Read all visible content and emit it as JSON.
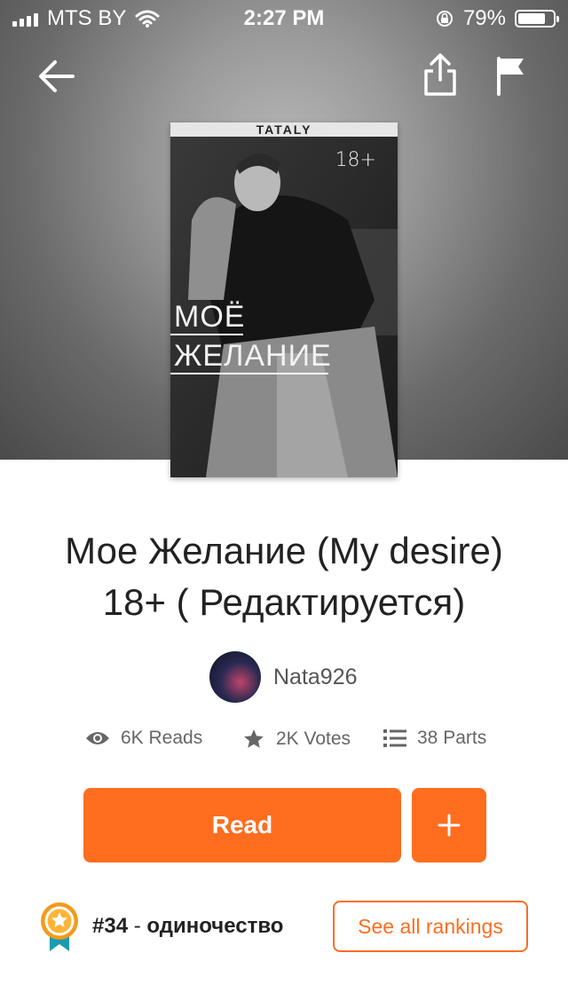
{
  "status_bar": {
    "carrier": "MTS BY",
    "time": "2:27 PM",
    "battery": "79%",
    "battery_level": 0.79
  },
  "nav": {
    "back_icon": "arrow-left-icon",
    "share_icon": "share-icon",
    "flag_icon": "flag-icon"
  },
  "cover": {
    "brand": "TATALY",
    "age_rating": "18+",
    "title_line1": "МОЁ",
    "title_line2": "ЖЕЛАНИЕ"
  },
  "story": {
    "title_line1": "Мое Желание (My desire)",
    "title_line2": "18+ ( Редактируется)"
  },
  "author": {
    "name": "Nata926"
  },
  "stats": {
    "reads": "6K Reads",
    "votes": "2K Votes",
    "parts": "38 Parts"
  },
  "actions": {
    "read_label": "Read",
    "add_label": "+"
  },
  "ranking": {
    "rank": "#34",
    "separator": " - ",
    "tag": "одиночество",
    "see_all_label": "See all rankings"
  },
  "colors": {
    "accent": "#ff6d1f",
    "text": "#222222",
    "muted": "#666666"
  }
}
